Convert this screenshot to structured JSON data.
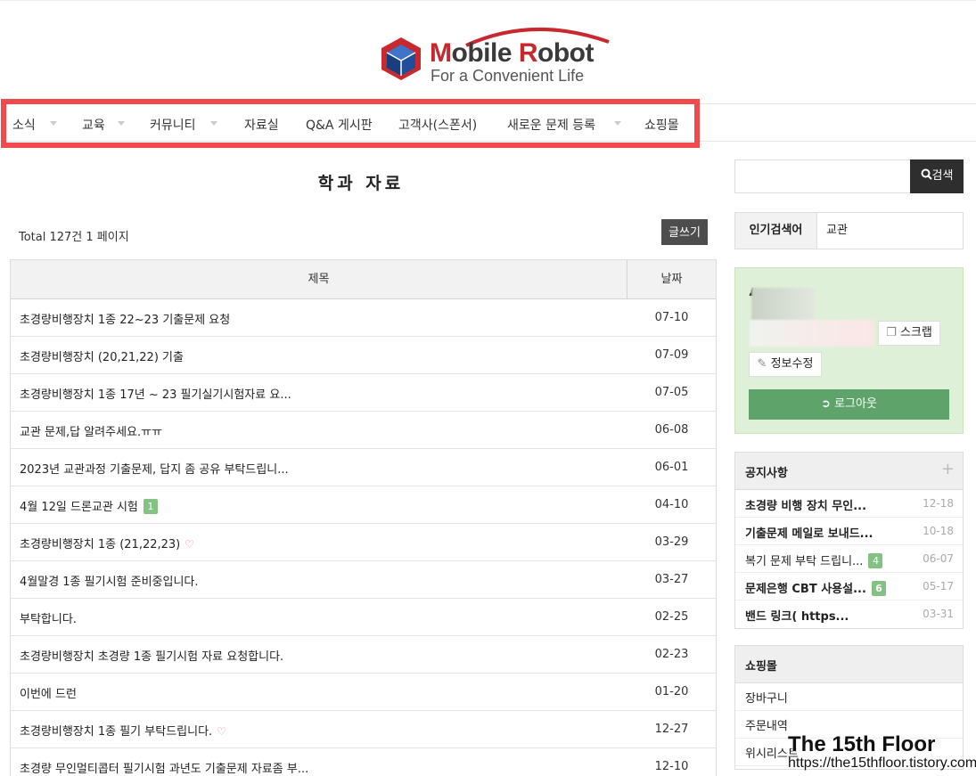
{
  "logo": {
    "title_first": "M",
    "title_rest_1": "obile ",
    "title_r": "R",
    "title_rest_2": "obot",
    "subtitle": "For a Convenient Life"
  },
  "nav": {
    "items": [
      {
        "label": "소식",
        "dropdown": true
      },
      {
        "label": "교육",
        "dropdown": true
      },
      {
        "label": "커뮤니티",
        "dropdown": true
      },
      {
        "label": "자료실",
        "dropdown": false
      },
      {
        "label": "Q&A 게시판",
        "dropdown": false
      },
      {
        "label": "고객사(스폰서)",
        "dropdown": false
      },
      {
        "label": "새로운 문제 등록",
        "dropdown": true
      },
      {
        "label": "쇼핑몰",
        "dropdown": false
      }
    ]
  },
  "board": {
    "title": "학과 자료",
    "total": "Total 127건 1 페이지",
    "write_label": "글쓰기",
    "col_title": "제목",
    "col_date": "날짜",
    "rows": [
      {
        "title": "초경량비행장치 1종 22~23 기출문제 요청",
        "date": "07-10",
        "badge": "",
        "heart": false
      },
      {
        "title": "초경량비행장치 (20,21,22) 기출",
        "date": "07-09",
        "badge": "",
        "heart": false
      },
      {
        "title": "초경량비행장치 1종 17년 ~ 23 필기실기시험자료 요...",
        "date": "07-05",
        "badge": "",
        "heart": false
      },
      {
        "title": "교관 문제,답 알려주세요.ㅠㅠ",
        "date": "06-08",
        "badge": "",
        "heart": false
      },
      {
        "title": "2023년 교관과정 기출문제, 답지 좀 공유 부탁드립니...",
        "date": "06-01",
        "badge": "",
        "heart": false
      },
      {
        "title": "4월 12일 드론교관 시험",
        "date": "04-10",
        "badge": "1",
        "heart": false
      },
      {
        "title": "초경량비행장치 1종 (21,22,23)",
        "date": "03-29",
        "badge": "",
        "heart": true
      },
      {
        "title": "4월말경 1종 필기시험 준비중입니다.",
        "date": "03-27",
        "badge": "",
        "heart": false
      },
      {
        "title": "부탁합니다.",
        "date": "02-25",
        "badge": "",
        "heart": false
      },
      {
        "title": "초경량비행장치 초경량 1종 필기시험 자료 요청합니다.",
        "date": "02-23",
        "badge": "",
        "heart": false
      },
      {
        "title": "이번에 드런",
        "date": "01-20",
        "badge": "",
        "heart": false
      },
      {
        "title": "초경량비행장치 1종 필기 부탁드립니다.",
        "date": "12-27",
        "badge": "",
        "heart": true
      },
      {
        "title": "초경량 무인멀티콥터 필기시험 과년도 기출문제 자료좀 부...",
        "date": "12-10",
        "badge": "",
        "heart": false
      }
    ]
  },
  "sidebar": {
    "search_button": "검색",
    "search_placeholder": "",
    "hot_label": "인기검색어",
    "hot_value": "교관",
    "scrap_label": "스크랩",
    "edit_label": "정보수정",
    "logout_label": "로그아웃",
    "notice": {
      "title": "공지사항",
      "items": [
        {
          "title": "초경량 비행 장치 무인...",
          "date": "12-18",
          "badge": "",
          "bold": true
        },
        {
          "title": "기출문제 메일로 보내드...",
          "date": "10-18",
          "badge": "",
          "bold": true
        },
        {
          "title": "복기 문제 부탁 드립니...",
          "date": "06-07",
          "badge": "4",
          "bold": false
        },
        {
          "title": "문제은행 CBT 사용설...",
          "date": "05-17",
          "badge": "6",
          "bold": true
        },
        {
          "title": "밴드 링크( https...",
          "date": "03-31",
          "badge": "",
          "bold": true
        }
      ]
    },
    "shop": {
      "title": "쇼핑몰",
      "items": [
        "장바구니",
        "주문내역",
        "위시리스트"
      ]
    }
  },
  "watermark": {
    "title": "The 15th Floor",
    "url": "https://the15thfloor.tistory.com"
  },
  "colors": {
    "highlight": "#f04a4f",
    "login_bg": "#dff0d8",
    "logout": "#5ea36a",
    "badge": "#83c283",
    "brand_red": "#c8292e"
  }
}
